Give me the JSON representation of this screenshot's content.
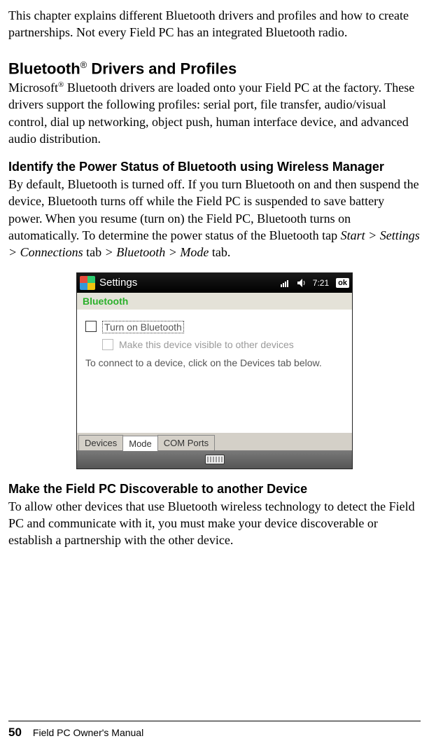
{
  "intro": "This chapter explains different Bluetooth drivers and profiles and how to create partnerships. Not every Field PC has an integrated Bluetooth radio.",
  "section1": {
    "heading_pre": "Bluetooth",
    "heading_reg": "®",
    "heading_post": " Drivers and Profiles",
    "p1_pre": "Microsoft",
    "p1_sup": "®",
    "p1_post": " Bluetooth drivers are loaded onto your Field PC at the factory. These drivers support the following profiles: serial port, file transfer, audio/visual control, dial up networking, object push, human interface device, and advanced audio distribution."
  },
  "section2": {
    "heading": "Identify the Power Status of Bluetooth using Wireless Manager",
    "body_pre": "By default, Bluetooth is turned off. If you turn Bluetooth on and then suspend the device, Bluetooth turns off while the Field PC is suspended to save battery power. When you resume (turn on) the Field PC, Bluetooth turns on automatically. To determine the power status of the Bluetooth tap ",
    "nav1": "Start > Settings > Connections",
    "tab_word": " tab ",
    "nav2": "> Bluetooth > Mode",
    "tab_word2": " tab."
  },
  "shot": {
    "titlebar": "Settings",
    "time": "7:21",
    "ok": "ok",
    "app": "Bluetooth",
    "chk1": "Turn on Bluetooth",
    "chk2": "Make this device visible to other devices",
    "info": "To connect to a device, click on the Devices tab below.",
    "tabs": [
      "Devices",
      "Mode",
      "COM Ports"
    ]
  },
  "section3": {
    "heading": "Make the Field PC Discoverable to another Device",
    "body": "To allow other devices that use Bluetooth wireless technology to detect the Field PC and communicate with it, you must make your device discoverable or establish a partnership with the other device."
  },
  "footer": {
    "page": "50",
    "title": "Field PC Owner's Manual"
  }
}
